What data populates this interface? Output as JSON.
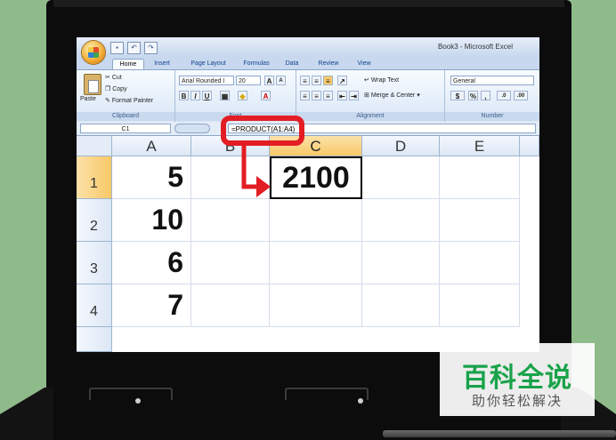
{
  "window": {
    "title": "Book3 - Microsoft Excel"
  },
  "ribbon": {
    "tabs": [
      "Home",
      "Insert",
      "Page Layout",
      "Formulas",
      "Data",
      "Review",
      "View"
    ],
    "active_tab": "Home",
    "clipboard": {
      "paste": "Paste",
      "cut": "Cut",
      "copy": "Copy",
      "format_painter": "Format Painter",
      "label": "Clipboard"
    },
    "font": {
      "name": "Arial Rounded I",
      "size": "20",
      "label": "Font"
    },
    "alignment": {
      "wrap_text": "Wrap Text",
      "merge_center": "Merge & Center",
      "label": "Alignment"
    },
    "number": {
      "format": "General",
      "percent": "%",
      "comma": ",",
      "label": "Number"
    }
  },
  "formula_bar": {
    "name_box": "C1",
    "formula": "=PRODUCT(A1:A4)"
  },
  "grid": {
    "columns": [
      "A",
      "B",
      "C",
      "D",
      "E"
    ],
    "rows": [
      "1",
      "2",
      "3",
      "4"
    ],
    "cells": {
      "A1": "5",
      "A2": "10",
      "A3": "6",
      "A4": "7",
      "C1": "2100"
    }
  },
  "watermark": {
    "title": "百科全说",
    "subtitle": "助你轻松解决"
  },
  "colors": {
    "highlight": "#e31d24",
    "selected_header": "#f8c868",
    "ribbon": "#d9e6f6",
    "background": "#8fbb8a"
  }
}
